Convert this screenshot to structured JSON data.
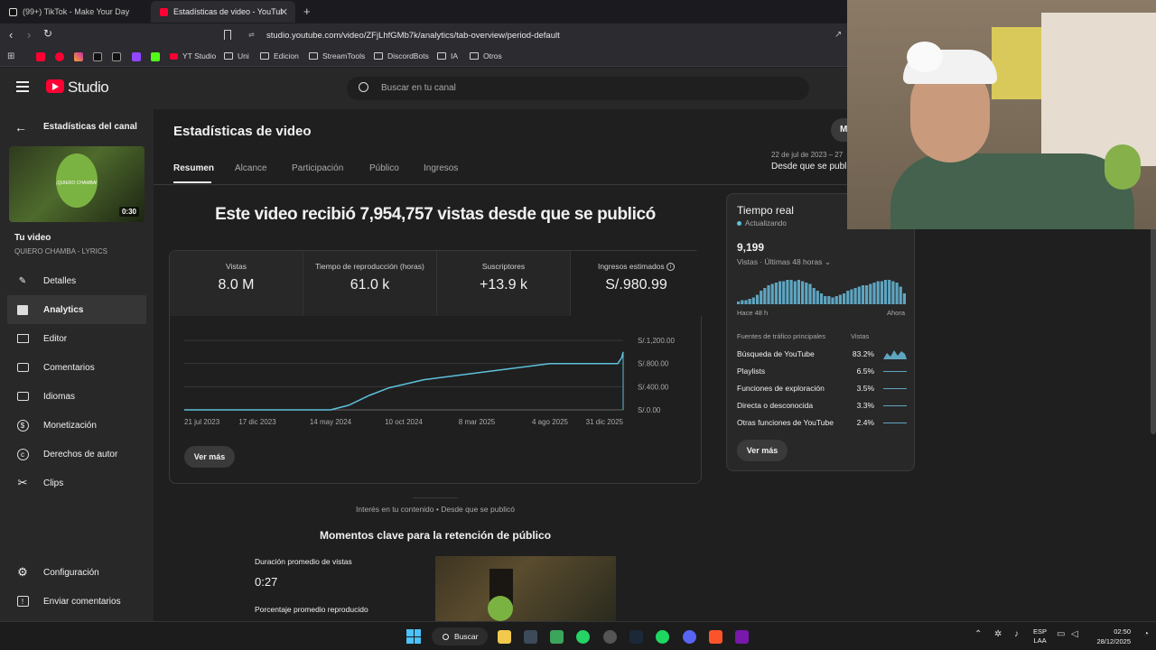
{
  "browser": {
    "tabs": [
      {
        "label": "(99+) TikTok - Make Your Day"
      },
      {
        "label": "Estadísticas de video - YouTube S"
      }
    ],
    "url": "studio.youtube.com/video/ZFjLhfGMb7k/analytics/tab-overview/period-default",
    "bookmarks": [
      "YT Studio",
      "Uni",
      "Edicion",
      "StreamTools",
      "DiscordBots",
      "IA",
      "Otros"
    ]
  },
  "studio": {
    "logo": "Studio",
    "search_placeholder": "Buscar en tu canal"
  },
  "sidebar": {
    "back_label": "Estadísticas del canal",
    "video_duration": "0:30",
    "thumb_caption": "¡QUIERO CHAMBA!",
    "your_video": "Tu video",
    "video_title": "QUIERO CHAMBA - LYRICS",
    "items": [
      {
        "label": "Detalles",
        "icon": "pencil-icon"
      },
      {
        "label": "Analytics",
        "icon": "analytics-icon"
      },
      {
        "label": "Editor",
        "icon": "editor-icon"
      },
      {
        "label": "Comentarios",
        "icon": "comments-icon"
      },
      {
        "label": "Idiomas",
        "icon": "subtitles-icon"
      },
      {
        "label": "Monetización",
        "icon": "dollar-icon"
      },
      {
        "label": "Derechos de autor",
        "icon": "copyright-icon"
      },
      {
        "label": "Clips",
        "icon": "scissors-icon"
      }
    ],
    "settings": "Configuración",
    "feedback": "Enviar comentarios"
  },
  "main": {
    "title": "Estadísticas de video",
    "mode_button": "M",
    "date_range_top": "22 de jul de 2023 – 27",
    "date_range_label": "Desde que se publi",
    "tabs": [
      "Resumen",
      "Alcance",
      "Participación",
      "Público",
      "Ingresos"
    ],
    "headline": "Este video recibió 7,954,757 vistas desde que se publicó",
    "metrics": [
      {
        "label": "Vistas",
        "value": "8.0 M"
      },
      {
        "label": "Tiempo de reproducción (horas)",
        "value": "61.0 k"
      },
      {
        "label": "Suscriptores",
        "value": "+13.9 k"
      },
      {
        "label": "Ingresos estimados",
        "value": "S/.980.99"
      }
    ],
    "see_more": "Ver más",
    "footer_note": "Interés en tu contenido • Desde que se publicó",
    "retention_title": "Momentos clave para la retención de público",
    "avg_duration_label": "Duración promedio de vistas",
    "avg_duration_value": "0:27",
    "avg_percent_label": "Porcentaje promedio reproducido"
  },
  "chart_data": {
    "type": "line",
    "metric": "Ingresos estimados",
    "x_tick_labels": [
      "21 jul 2023",
      "17 dic 2023",
      "14 may 2024",
      "10 oct 2024",
      "8 mar 2025",
      "4 ago 2025",
      "31 dic 2025"
    ],
    "y_tick_labels": [
      "S/.0.00",
      "S/.400.00",
      "S/.800.00",
      "S/.1,200.00"
    ],
    "ylim": [
      0,
      1200
    ],
    "x": [
      "2023-07-21",
      "2024-05-14",
      "2024-06-20",
      "2024-08-01",
      "2024-09-10",
      "2024-11-20",
      "2025-08-04",
      "2025-12-20",
      "2025-12-28",
      "2025-12-31"
    ],
    "values": [
      0,
      0,
      80,
      250,
      380,
      520,
      800,
      800,
      900,
      1000
    ],
    "color": "#5ec1dc"
  },
  "realtime": {
    "title": "Tiempo real",
    "status": "Actualizando",
    "count": "9,199",
    "subtitle": "Vistas · Últimas 48 horas",
    "left_label": "Hace 48 h",
    "right_label": "Ahora",
    "bar_fractions": [
      0.1,
      0.15,
      0.15,
      0.2,
      0.25,
      0.35,
      0.5,
      0.6,
      0.7,
      0.75,
      0.8,
      0.85,
      0.85,
      0.9,
      0.9,
      0.85,
      0.9,
      0.85,
      0.8,
      0.75,
      0.6,
      0.5,
      0.4,
      0.3,
      0.3,
      0.25,
      0.3,
      0.35,
      0.4,
      0.5,
      0.55,
      0.6,
      0.65,
      0.7,
      0.7,
      0.75,
      0.8,
      0.85,
      0.85,
      0.9,
      0.9,
      0.85,
      0.8,
      0.65,
      0.4
    ],
    "sources_header": "Fuentes de tráfico principales",
    "views_header": "Vistas",
    "sources": [
      {
        "name": "Búsqueda de YouTube",
        "percent": "83.2%"
      },
      {
        "name": "Playlists",
        "percent": "6.5%"
      },
      {
        "name": "Funciones de exploración",
        "percent": "3.5%"
      },
      {
        "name": "Directa o desconocida",
        "percent": "3.3%"
      },
      {
        "name": "Otras funciones de YouTube",
        "percent": "2.4%"
      }
    ],
    "see_more": "Ver más"
  },
  "taskbar": {
    "search": "Buscar",
    "lang": "ESP",
    "lang2": "LAA",
    "time": "02:50",
    "date": "28/12/2025"
  },
  "colors": {
    "accent": "#5ec1dc",
    "youtube_red": "#ff0033"
  }
}
